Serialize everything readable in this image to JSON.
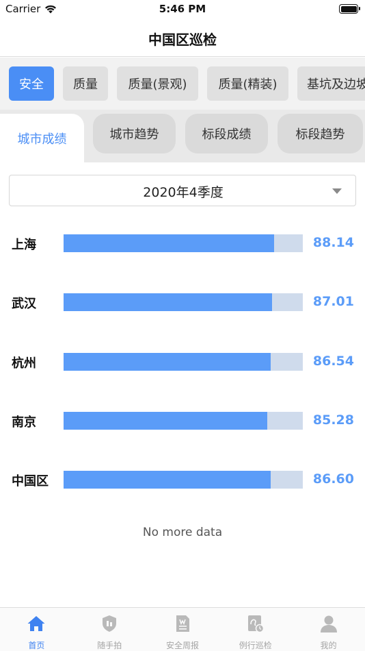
{
  "status_bar": {
    "carrier": "Carrier",
    "time": "5:46 PM"
  },
  "nav": {
    "title": "中国区巡检"
  },
  "categories": [
    {
      "label": "安全",
      "active": true
    },
    {
      "label": "质量",
      "active": false
    },
    {
      "label": "质量(景观)",
      "active": false
    },
    {
      "label": "质量(精装)",
      "active": false
    },
    {
      "label": "基坑及边坡",
      "active": false
    }
  ],
  "subtabs": [
    {
      "label": "城市成绩",
      "active": true
    },
    {
      "label": "城市趋势",
      "active": false
    },
    {
      "label": "标段成绩",
      "active": false
    },
    {
      "label": "标段趋势",
      "active": false
    }
  ],
  "period": {
    "selected": "2020年4季度"
  },
  "chart_data": {
    "type": "bar",
    "orientation": "horizontal",
    "categories": [
      "上海",
      "武汉",
      "杭州",
      "南京",
      "中国区"
    ],
    "values": [
      88.14,
      87.01,
      86.54,
      85.28,
      86.6
    ],
    "value_labels": [
      "88.14",
      "87.01",
      "86.54",
      "85.28",
      "86.60"
    ],
    "xlim": [
      0,
      100
    ],
    "colors": {
      "fill": "#5b9cf8",
      "track": "#cfdbec"
    }
  },
  "list_footer": {
    "no_more_text": "No more data"
  },
  "tab_bar": [
    {
      "label": "首页",
      "icon": "home-icon",
      "active": true
    },
    {
      "label": "随手拍",
      "icon": "shield-icon",
      "active": false
    },
    {
      "label": "安全周报",
      "icon": "report-icon",
      "active": false
    },
    {
      "label": "例行巡检",
      "icon": "inspection-icon",
      "active": false
    },
    {
      "label": "我的",
      "icon": "person-icon",
      "active": false
    }
  ],
  "colors": {
    "accent": "#4a8ef5",
    "tab_active": "#3f82f0",
    "tab_inactive": "#a5a5a5"
  }
}
